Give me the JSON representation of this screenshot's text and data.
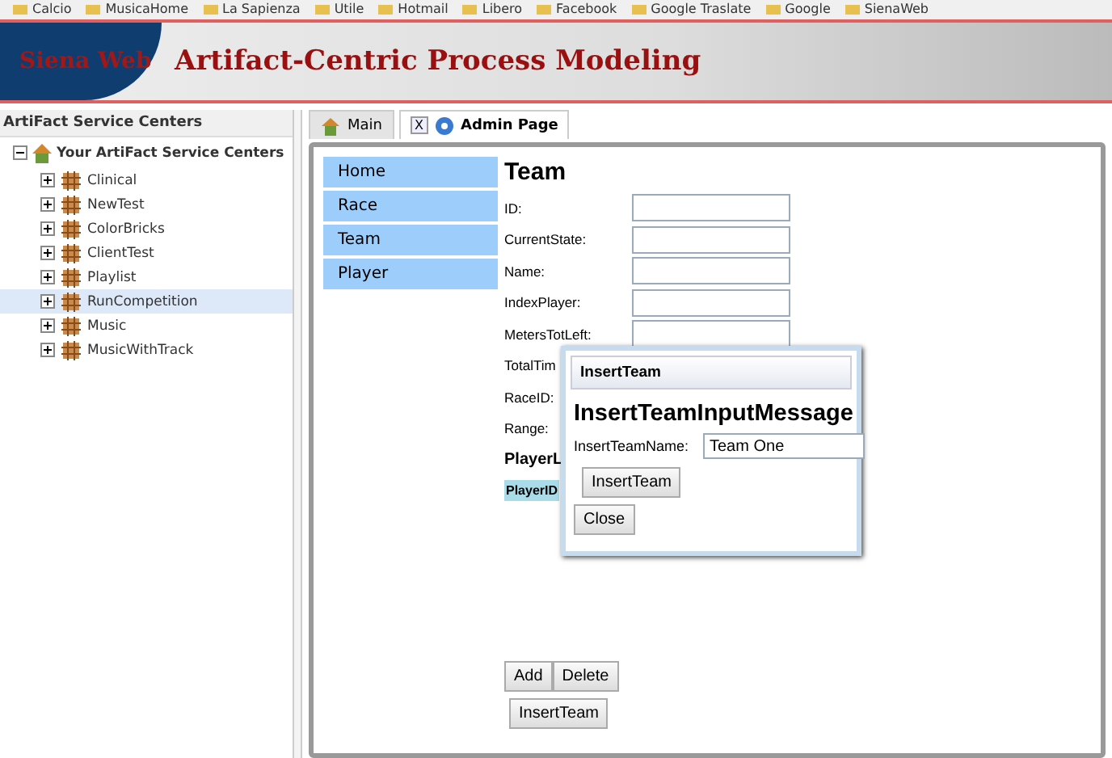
{
  "bookmarks": [
    "Calcio",
    "MusicaHome",
    "La Sapienza",
    "Utile",
    "Hotmail",
    "Libero",
    "Facebook",
    "Google Traslate",
    "Google",
    "SienaWeb"
  ],
  "banner": {
    "brand": "Siena Web",
    "title": "Artifact-Centric Process Modeling"
  },
  "sidebar": {
    "header": "ArtiFact Service Centers",
    "root": {
      "label": "Your ArtiFact Service Centers",
      "expanded": true,
      "children": [
        {
          "label": "Clinical",
          "selected": false
        },
        {
          "label": "NewTest",
          "selected": false
        },
        {
          "label": "ColorBricks",
          "selected": false
        },
        {
          "label": "ClientTest",
          "selected": false
        },
        {
          "label": "Playlist",
          "selected": false
        },
        {
          "label": "RunCompetition",
          "selected": true
        },
        {
          "label": "Music",
          "selected": false
        },
        {
          "label": "MusicWithTrack",
          "selected": false
        }
      ]
    }
  },
  "tabs": [
    {
      "label": "Main",
      "selected": false,
      "closable": false
    },
    {
      "label": "Admin Page",
      "selected": true,
      "closable": true,
      "close_label": "X"
    }
  ],
  "nav": [
    {
      "label": "Home"
    },
    {
      "label": "Race"
    },
    {
      "label": "Team"
    },
    {
      "label": "Player"
    }
  ],
  "form": {
    "title": "Team",
    "fields": [
      {
        "label": "ID:"
      },
      {
        "label": "CurrentState:"
      },
      {
        "label": "Name:"
      },
      {
        "label": "IndexPlayer:"
      },
      {
        "label": "MetersTotLeft:"
      },
      {
        "label": "TotalTim"
      },
      {
        "label": "RaceID:"
      },
      {
        "label": "Range:"
      }
    ],
    "list_title": "PlayerL",
    "list_column": "PlayerID",
    "buttons": [
      "Add",
      "Delete"
    ],
    "action": "InsertTeam"
  },
  "dialog": {
    "title": "InsertTeam",
    "heading": "InsertTeamInputMessage",
    "field_label": "InsertTeamName:",
    "field_value": "Team One",
    "submit": "InsertTeam",
    "close": "Close"
  }
}
